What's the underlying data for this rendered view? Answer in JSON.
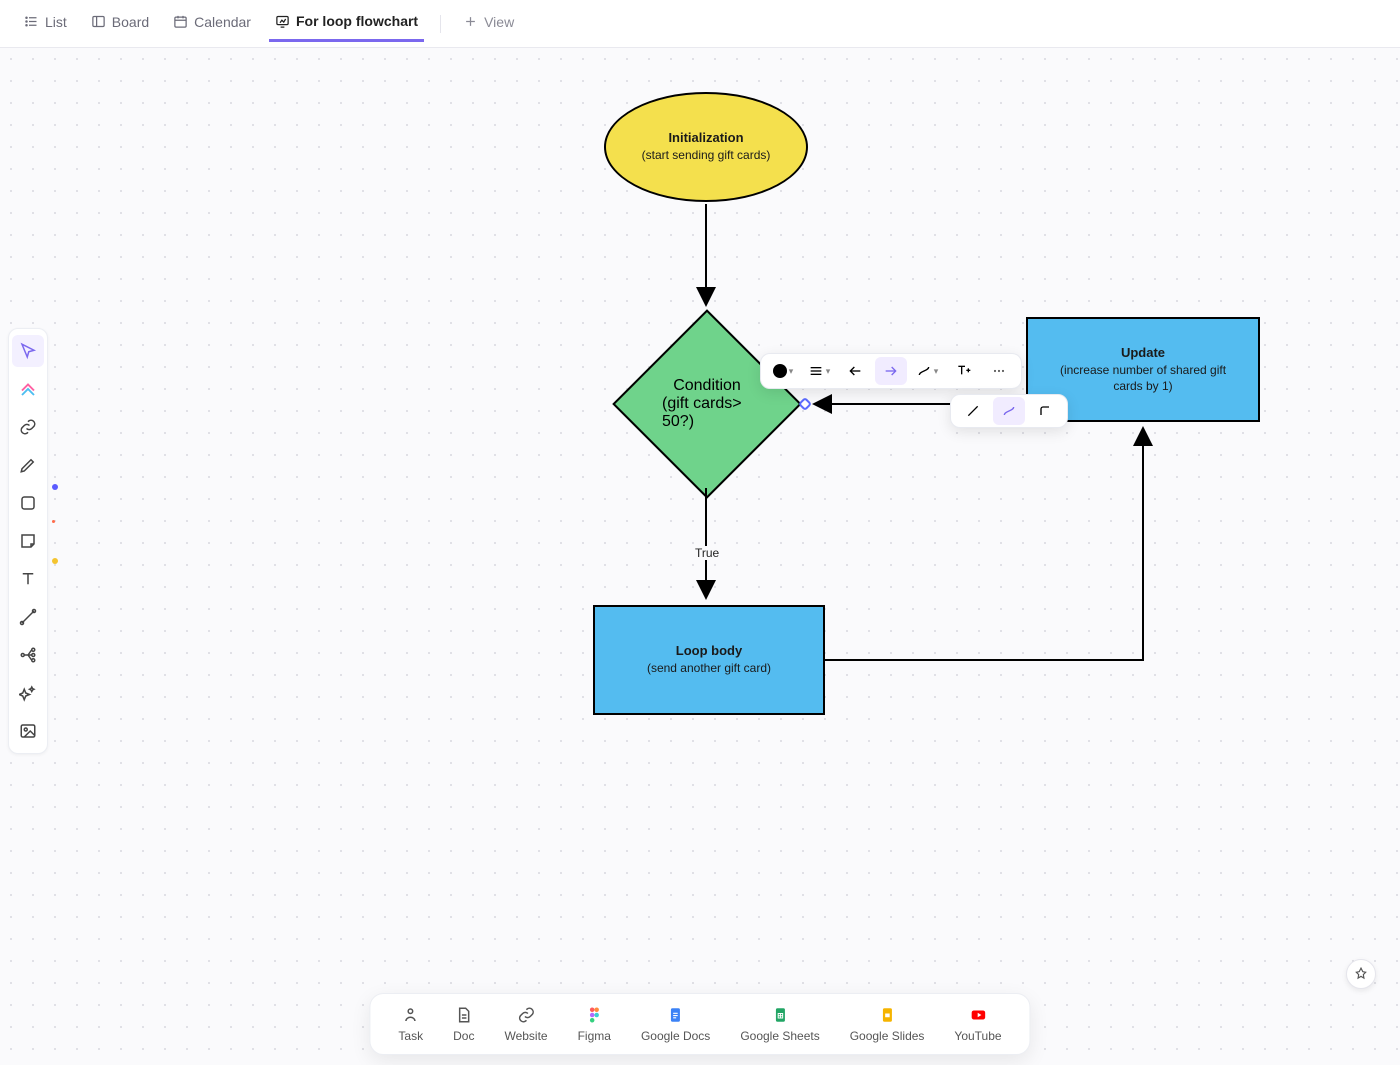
{
  "tabs": {
    "list": "List",
    "board": "Board",
    "calendar": "Calendar",
    "flowchart": "For loop flowchart",
    "add_view": "View"
  },
  "shapes": {
    "init": {
      "title": "Initialization",
      "sub": "(start sending gift cards)"
    },
    "cond": {
      "title": "Condition",
      "sub": "(gift cards> 50?)"
    },
    "loop": {
      "title": "Loop body",
      "sub": "(send another gift card)"
    },
    "update": {
      "title": "Update",
      "sub": "(increase number of shared gift cards by 1)"
    }
  },
  "edge_label_true": "True",
  "dock": {
    "task": "Task",
    "doc": "Doc",
    "website": "Website",
    "figma": "Figma",
    "gdocs": "Google Docs",
    "gsheets": "Google Sheets",
    "gslides": "Google Slides",
    "youtube": "YouTube"
  },
  "chart_data": {
    "type": "flowchart",
    "nodes": [
      {
        "id": "init",
        "shape": "ellipse",
        "title": "Initialization",
        "subtitle": "(start sending gift cards)"
      },
      {
        "id": "cond",
        "shape": "diamond",
        "title": "Condition",
        "subtitle": "(gift cards> 50?)"
      },
      {
        "id": "loop",
        "shape": "rect",
        "title": "Loop body",
        "subtitle": "(send another gift card)"
      },
      {
        "id": "update",
        "shape": "rect",
        "title": "Update",
        "subtitle": "(increase number of shared gift cards by 1)"
      }
    ],
    "edges": [
      {
        "from": "init",
        "to": "cond"
      },
      {
        "from": "cond",
        "to": "loop",
        "label": "True"
      },
      {
        "from": "loop",
        "to": "update"
      },
      {
        "from": "update",
        "to": "cond"
      }
    ]
  }
}
